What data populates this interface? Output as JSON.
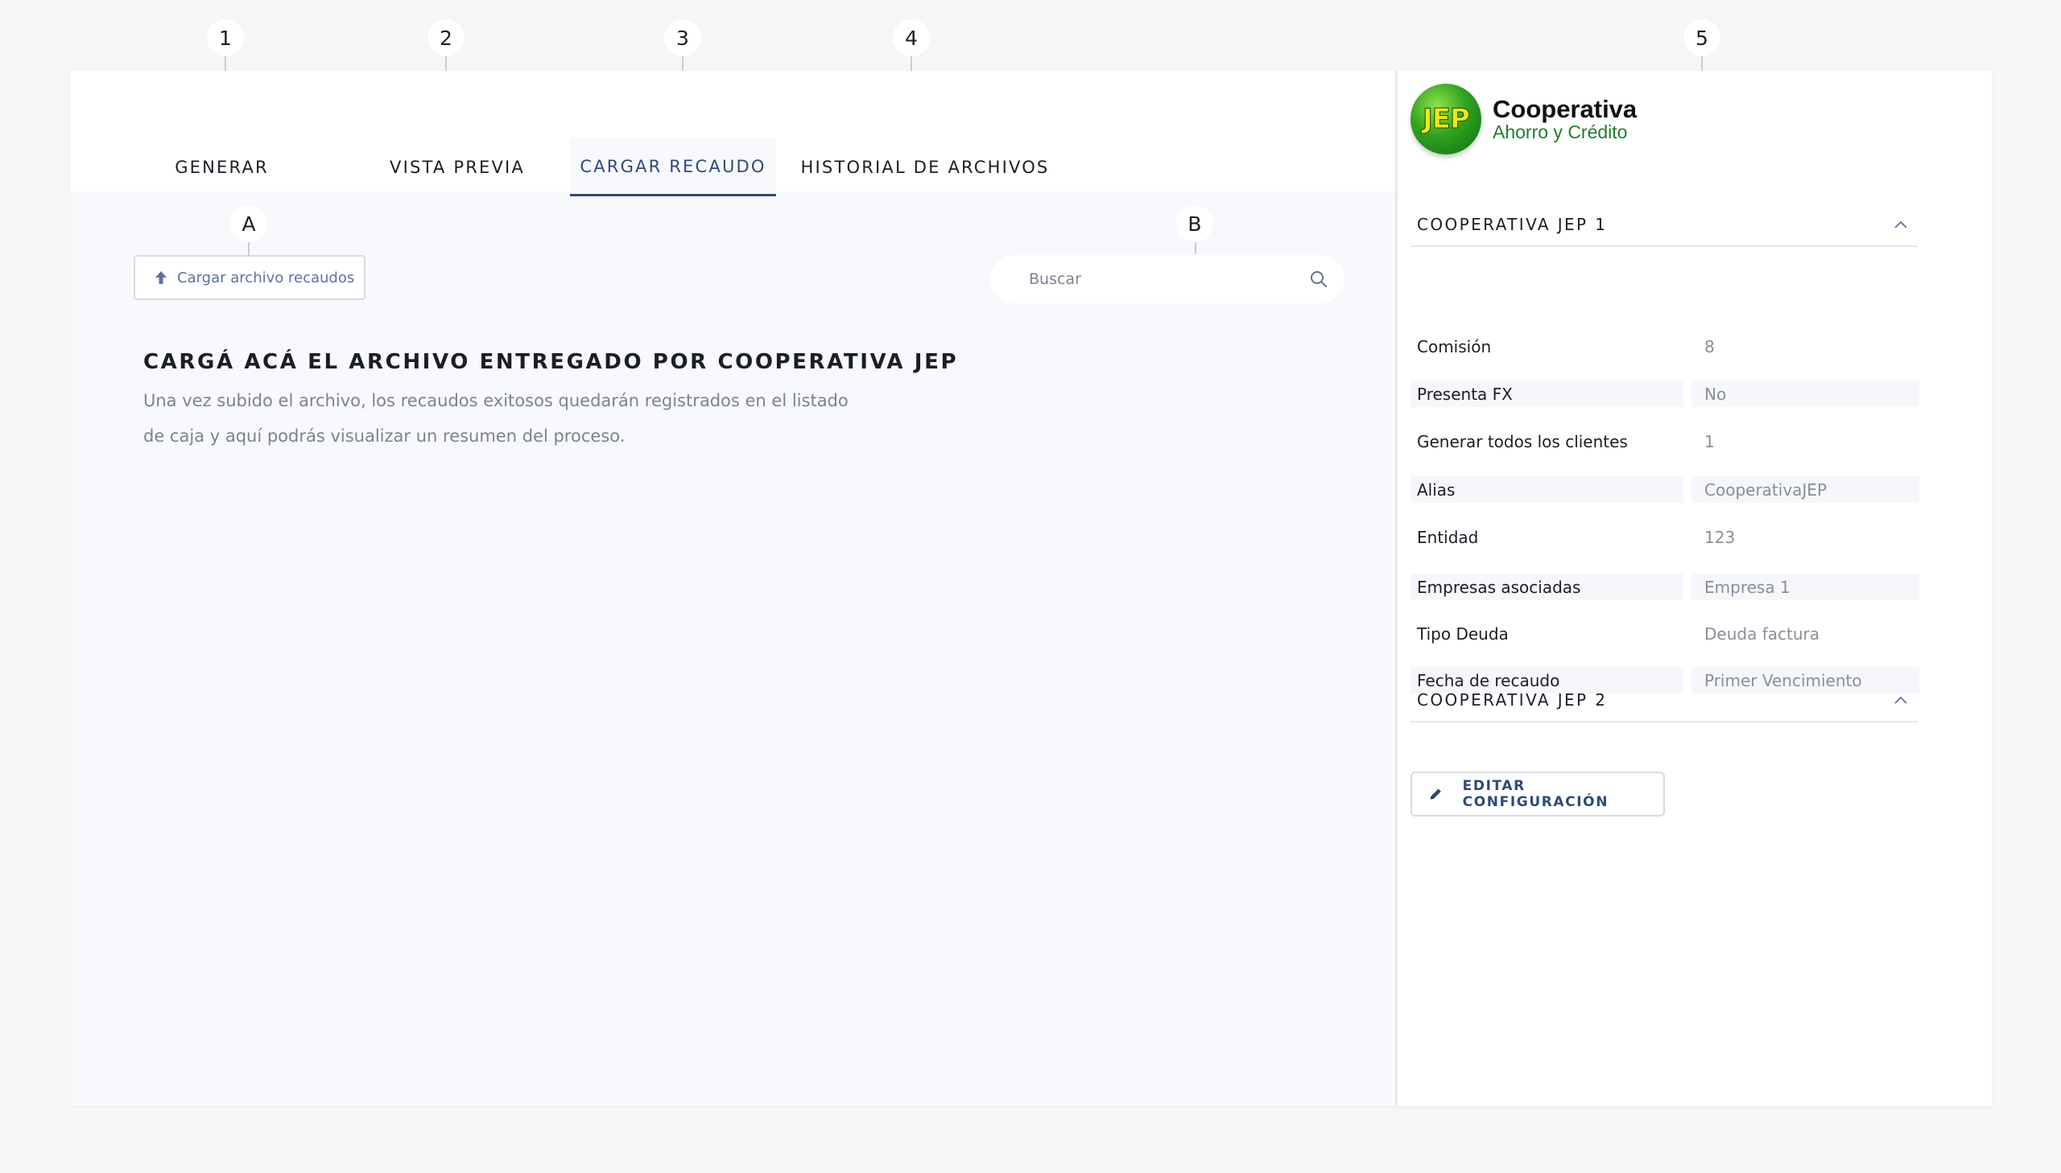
{
  "tabs": [
    {
      "label": "GENERAR"
    },
    {
      "label": "VISTA PREVIA"
    },
    {
      "label": "CARGAR RECAUDO"
    },
    {
      "label": "HISTORIAL DE ARCHIVOS"
    }
  ],
  "active_tab": "CARGAR RECAUDO",
  "upload": {
    "label": "Cargar archivo recaudos",
    "icon": "upload-arrow-icon"
  },
  "search": {
    "placeholder": "Buscar",
    "value": "",
    "icon": "search-icon"
  },
  "content": {
    "title": "CARGÁ ACÁ EL ARCHIVO ENTREGADO POR COOPERATIVA JEP",
    "description": "Una vez subido el archivo, los recaudos exitosos quedarán registrados en el listado de caja y aquí podrás visualizar un resumen del proceso."
  },
  "logo": {
    "mark": "JEP",
    "line1": "Cooperativa",
    "line2": "Ahorro y Crédito"
  },
  "sections": [
    {
      "title": "COOPERATIVA JEP 1",
      "expanded": true,
      "fields": [
        {
          "label": "Comisión",
          "value": "8"
        },
        {
          "label": "Presenta FX",
          "value": "No"
        },
        {
          "label": "Generar todos los clientes",
          "value": "1"
        },
        {
          "label": "Alias",
          "value": "CooperativaJEP"
        },
        {
          "label": "Entidad",
          "value": "123"
        },
        {
          "label": "Empresas asociadas",
          "value": "Empresa 1"
        },
        {
          "label": "Tipo Deuda",
          "value": "Deuda factura"
        },
        {
          "label": "Fecha de recaudo",
          "value": "Primer Vencimiento"
        }
      ]
    },
    {
      "title": "COOPERATIVA JEP 2",
      "expanded": true,
      "fields": []
    }
  ],
  "edit_button": {
    "label": "EDITAR CONFIGURACIÓN",
    "icon": "pencil-icon"
  },
  "markers": [
    "1",
    "2",
    "3",
    "4",
    "5",
    "A",
    "B"
  ],
  "colors": {
    "accent": "#2d4a7a",
    "muted_text": "#7d8290",
    "brand_green": "#2fa21e",
    "brand_yellow": "#f6e516"
  }
}
